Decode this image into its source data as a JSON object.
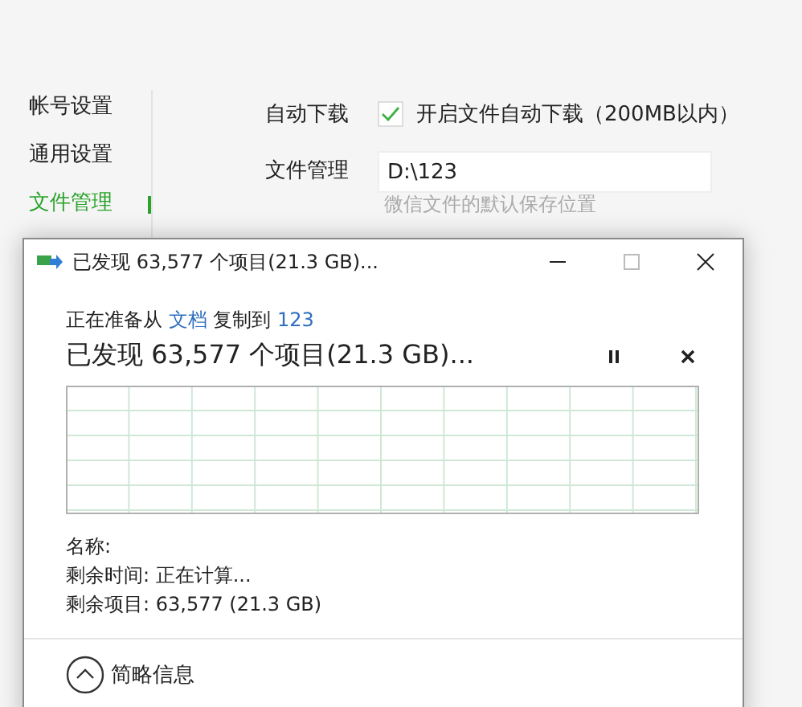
{
  "sidebar": {
    "items": [
      {
        "label": "帐号设置",
        "selected": false
      },
      {
        "label": "通用设置",
        "selected": false
      },
      {
        "label": "文件管理",
        "selected": true
      }
    ]
  },
  "auto_download": {
    "label": "自动下载",
    "option": "开启文件自动下载（200MB以内）",
    "checked": true
  },
  "file_management": {
    "label": "文件管理",
    "value": "D:\\123",
    "hint": "微信文件的默认保存位置"
  },
  "dialog": {
    "title": "已发现 63,577 个项目(21.3 GB)...",
    "status": {
      "prefix": "正在准备从",
      "source": "文档",
      "middle": "复制到",
      "destination": "123"
    },
    "heading": "已发现 63,577 个项目(21.3 GB)...",
    "details": [
      "名称:",
      "剩余时间: 正在计算...",
      "剩余项目: 63,577 (21.3 GB)"
    ],
    "details_toggle": {
      "label": "简略信息",
      "expanded": true
    }
  }
}
